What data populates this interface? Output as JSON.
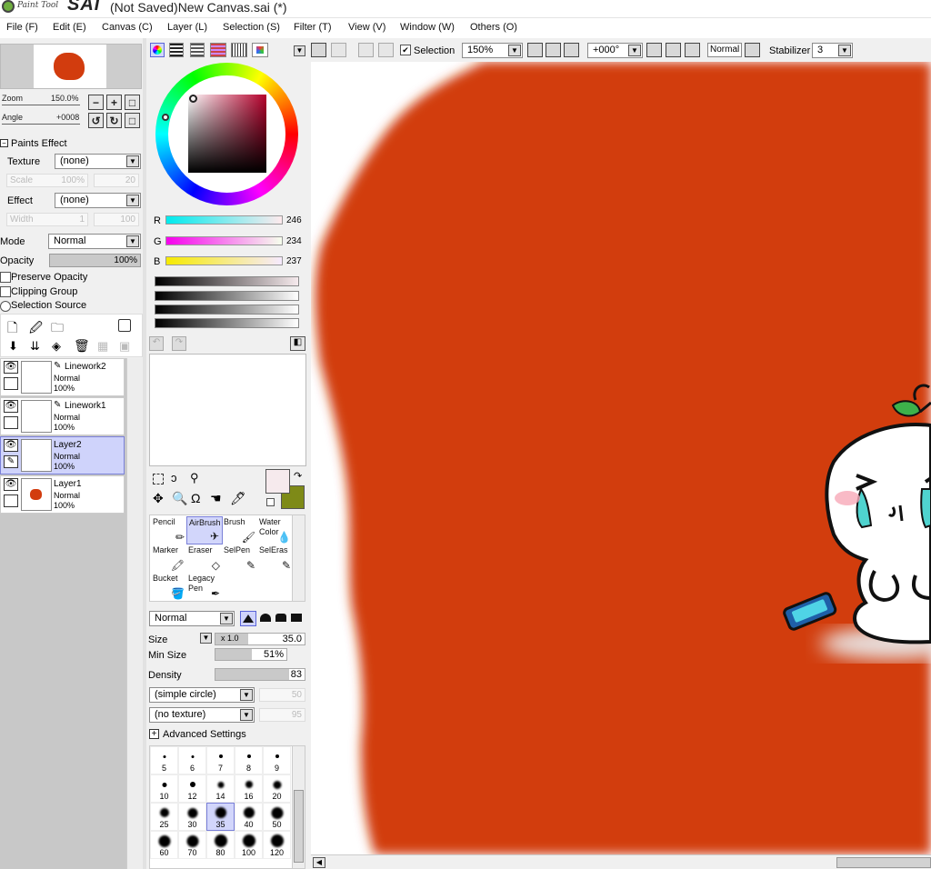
{
  "app": {
    "logo_text_small": "Paint Tool",
    "logo_text": "SAI",
    "window_title": "(Not Saved)New Canvas.sai (*)"
  },
  "menu": [
    "File (F)",
    "Edit (E)",
    "Canvas (C)",
    "Layer (L)",
    "Selection (S)",
    "Filter (T)",
    "View (V)",
    "Window (W)",
    "Others (O)"
  ],
  "navigator": {
    "zoom_label": "Zoom",
    "zoom_value": "150.0%",
    "angle_label": "Angle",
    "angle_value": "+0008"
  },
  "paints_effect": {
    "header": "Paints Effect",
    "texture_label": "Texture",
    "texture_value": "(none)",
    "scale_label": "Scale",
    "scale_value": "100%",
    "scale_num": "20",
    "effect_label": "Effect",
    "effect_value": "(none)",
    "width_label": "Width",
    "width_value": "1",
    "width_num": "100"
  },
  "layer_props": {
    "mode_label": "Mode",
    "mode_value": "Normal",
    "opacity_label": "Opacity",
    "opacity_value": "100%",
    "preserve_opacity": "Preserve Opacity",
    "clipping_group": "Clipping Group",
    "selection_source": "Selection Source"
  },
  "layers": [
    {
      "name": "Linework2",
      "mode": "Normal",
      "opacity": "100%",
      "pen": true,
      "selected": false
    },
    {
      "name": "Linework1",
      "mode": "Normal",
      "opacity": "100%",
      "pen": true,
      "selected": false
    },
    {
      "name": "Layer2",
      "mode": "Normal",
      "opacity": "100%",
      "pen": false,
      "selected": true
    },
    {
      "name": "Layer1",
      "mode": "Normal",
      "opacity": "100%",
      "pen": false,
      "selected": false
    }
  ],
  "color": {
    "r_label": "R",
    "r_value": "246",
    "g_label": "G",
    "g_value": "234",
    "b_label": "B",
    "b_value": "237",
    "primary": "#f6eaed",
    "secondary": "#7e8a17"
  },
  "tools": [
    {
      "name": "Pencil",
      "selected": false
    },
    {
      "name": "AirBrush",
      "selected": true
    },
    {
      "name": "Brush",
      "selected": false
    },
    {
      "name": "Water Color",
      "selected": false
    },
    {
      "name": "Marker",
      "selected": false
    },
    {
      "name": "Eraser",
      "selected": false
    },
    {
      "name": "SelPen",
      "selected": false
    },
    {
      "name": "SelEras",
      "selected": false
    },
    {
      "name": "Bucket",
      "selected": false
    },
    {
      "name": "Legacy Pen",
      "selected": false
    }
  ],
  "brush": {
    "mode_value": "Normal",
    "size_label": "Size",
    "size_mult": "x 1.0",
    "size_value": "35.0",
    "min_size_label": "Min Size",
    "min_size_value": "51%",
    "min_size_pct": 51,
    "density_label": "Density",
    "density_value": "83",
    "density_pct": 83,
    "shape_value": "(simple circle)",
    "shape_num": "50",
    "texture_value": "(no texture)",
    "texture_num": "95",
    "advanced": "Advanced Settings"
  },
  "brush_sizes": [
    {
      "label": "5",
      "d": 3
    },
    {
      "label": "6",
      "d": 3
    },
    {
      "label": "7",
      "d": 4
    },
    {
      "label": "8",
      "d": 4
    },
    {
      "label": "9",
      "d": 4
    },
    {
      "label": "10",
      "d": 5
    },
    {
      "label": "12",
      "d": 6
    },
    {
      "label": "14",
      "d": 7
    },
    {
      "label": "16",
      "d": 8
    },
    {
      "label": "20",
      "d": 9
    },
    {
      "label": "25",
      "d": 10
    },
    {
      "label": "30",
      "d": 11
    },
    {
      "label": "35",
      "d": 12
    },
    {
      "label": "40",
      "d": 12
    },
    {
      "label": "50",
      "d": 13
    },
    {
      "label": "60",
      "d": 13
    },
    {
      "label": "70",
      "d": 13
    },
    {
      "label": "80",
      "d": 14
    },
    {
      "label": "100",
      "d": 14
    },
    {
      "label": "120",
      "d": 14
    }
  ],
  "toolbar": {
    "selection_label": "Selection",
    "zoom_value": "150%",
    "angle_value": "+000°",
    "blend_value": "Normal",
    "stabilizer_label": "Stabilizer",
    "stabilizer_value": "3"
  },
  "canvas": {
    "fill_color": "#d23c0e"
  }
}
